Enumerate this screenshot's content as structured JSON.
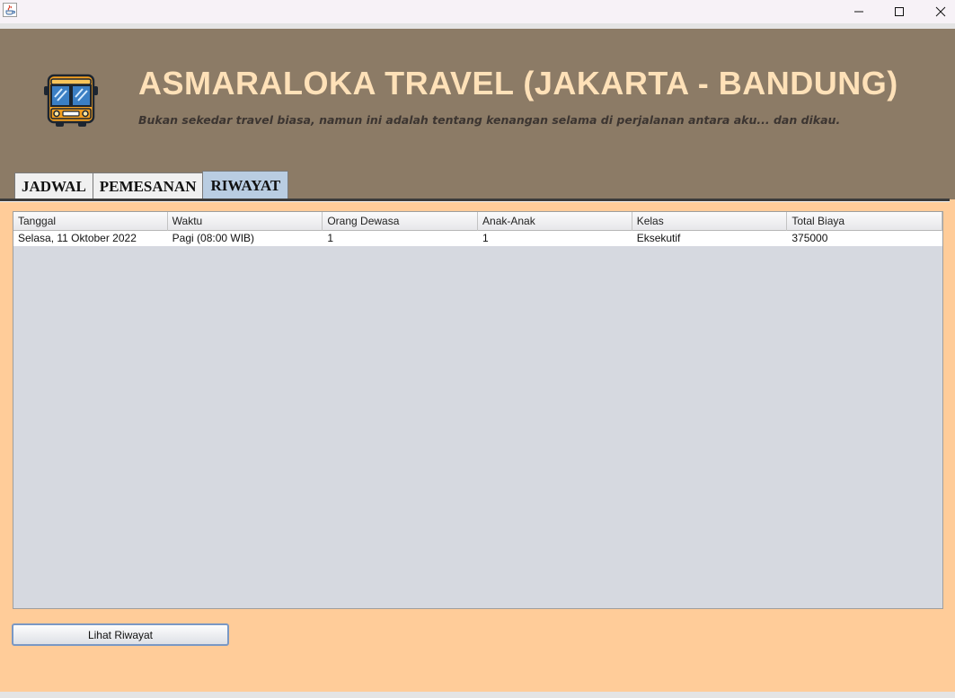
{
  "window": {
    "app_icon": "java-cup-icon",
    "controls": [
      "minimize-icon",
      "maximize-icon",
      "close-icon"
    ]
  },
  "header": {
    "logo_icon": "bus-icon",
    "title": "ASMARALOKA TRAVEL (JAKARTA - BANDUNG)",
    "subtitle": "Bukan sekedar travel biasa, namun ini adalah tentang kenangan selama di perjalanan antara aku... dan dikau."
  },
  "tabs": [
    {
      "label": "JADWAL",
      "active": false
    },
    {
      "label": "PEMESANAN",
      "active": false
    },
    {
      "label": "RIWAYAT",
      "active": true
    }
  ],
  "table": {
    "columns": [
      "Tanggal",
      "Waktu",
      "Orang Dewasa",
      "Anak-Anak",
      "Kelas",
      "Total Biaya"
    ],
    "rows": [
      [
        "Selasa, 11 Oktober 2022",
        "Pagi (08:00 WIB)",
        "1",
        "1",
        "Eksekutif",
        "375000"
      ]
    ]
  },
  "actions": {
    "lihat_riwayat_label": "Lihat Riwayat"
  },
  "colors": {
    "header_bg": "#8c7b66",
    "title_color": "#ffe1b8",
    "body_bg": "#ffcc99",
    "active_tab": "#b9cde2"
  }
}
